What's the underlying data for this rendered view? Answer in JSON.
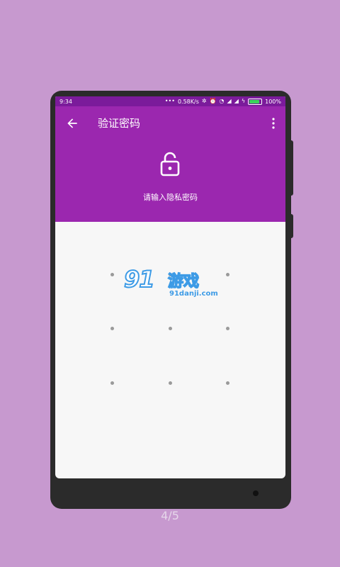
{
  "status_bar": {
    "time": "9:34",
    "network_speed": "0.58K/s",
    "battery": "100%",
    "battery_color": "#39d35b"
  },
  "header": {
    "title": "验证密码",
    "hint": "请输入隐私密码",
    "color": "#9b27af"
  },
  "watermark": {
    "logo": "91",
    "brand": "游戏",
    "url": "91danji.com"
  },
  "pager": "4/5",
  "icons": {
    "back": "arrow-left-icon",
    "more": "more-vert-icon",
    "lock": "lock-open-icon"
  }
}
